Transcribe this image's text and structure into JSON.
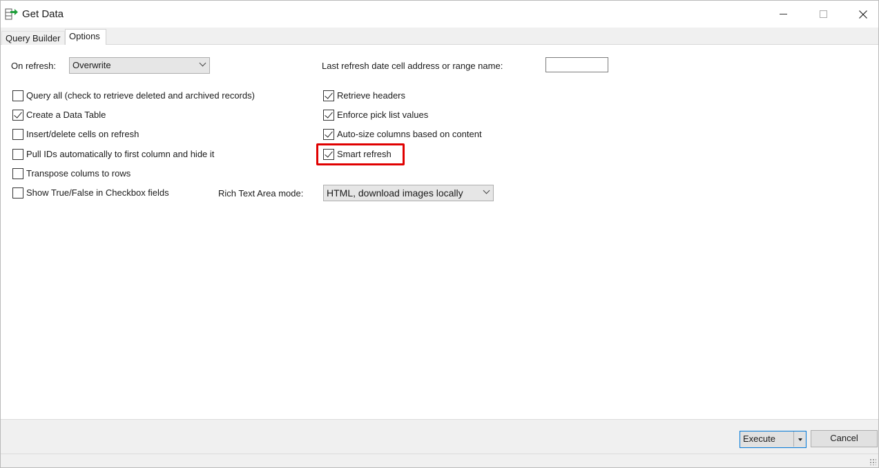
{
  "window": {
    "title": "Get Data"
  },
  "tabs": [
    {
      "label": "Query Builder",
      "active": false
    },
    {
      "label": "Options",
      "active": true
    }
  ],
  "options": {
    "on_refresh_label": "On refresh:",
    "on_refresh_value": "Overwrite",
    "last_refresh_label": "Last refresh date cell address or range name:",
    "last_refresh_value": "",
    "rich_text_label": "Rich Text Area mode:",
    "rich_text_value": "HTML, download images locally",
    "left_checkboxes": [
      {
        "label": "Query all (check to retrieve deleted and archived records)",
        "checked": false
      },
      {
        "label": "Create a Data Table",
        "checked": true
      },
      {
        "label": "Insert/delete cells on refresh",
        "checked": false
      },
      {
        "label": "Pull IDs automatically to first column and hide it",
        "checked": false
      },
      {
        "label": "Transpose colums to rows",
        "checked": false
      },
      {
        "label": "Show True/False in Checkbox fields",
        "checked": false
      }
    ],
    "right_checkboxes": [
      {
        "label": "Retrieve headers",
        "checked": true
      },
      {
        "label": "Enforce pick list values",
        "checked": true
      },
      {
        "label": "Auto-size columns based on content",
        "checked": true
      },
      {
        "label": "Smart refresh",
        "checked": true,
        "highlighted": true
      }
    ]
  },
  "buttons": {
    "execute": "Execute",
    "cancel": "Cancel"
  },
  "colors": {
    "highlight": "#e00000",
    "accent": "#0078d7",
    "icon_green": "#1e9e3a"
  }
}
